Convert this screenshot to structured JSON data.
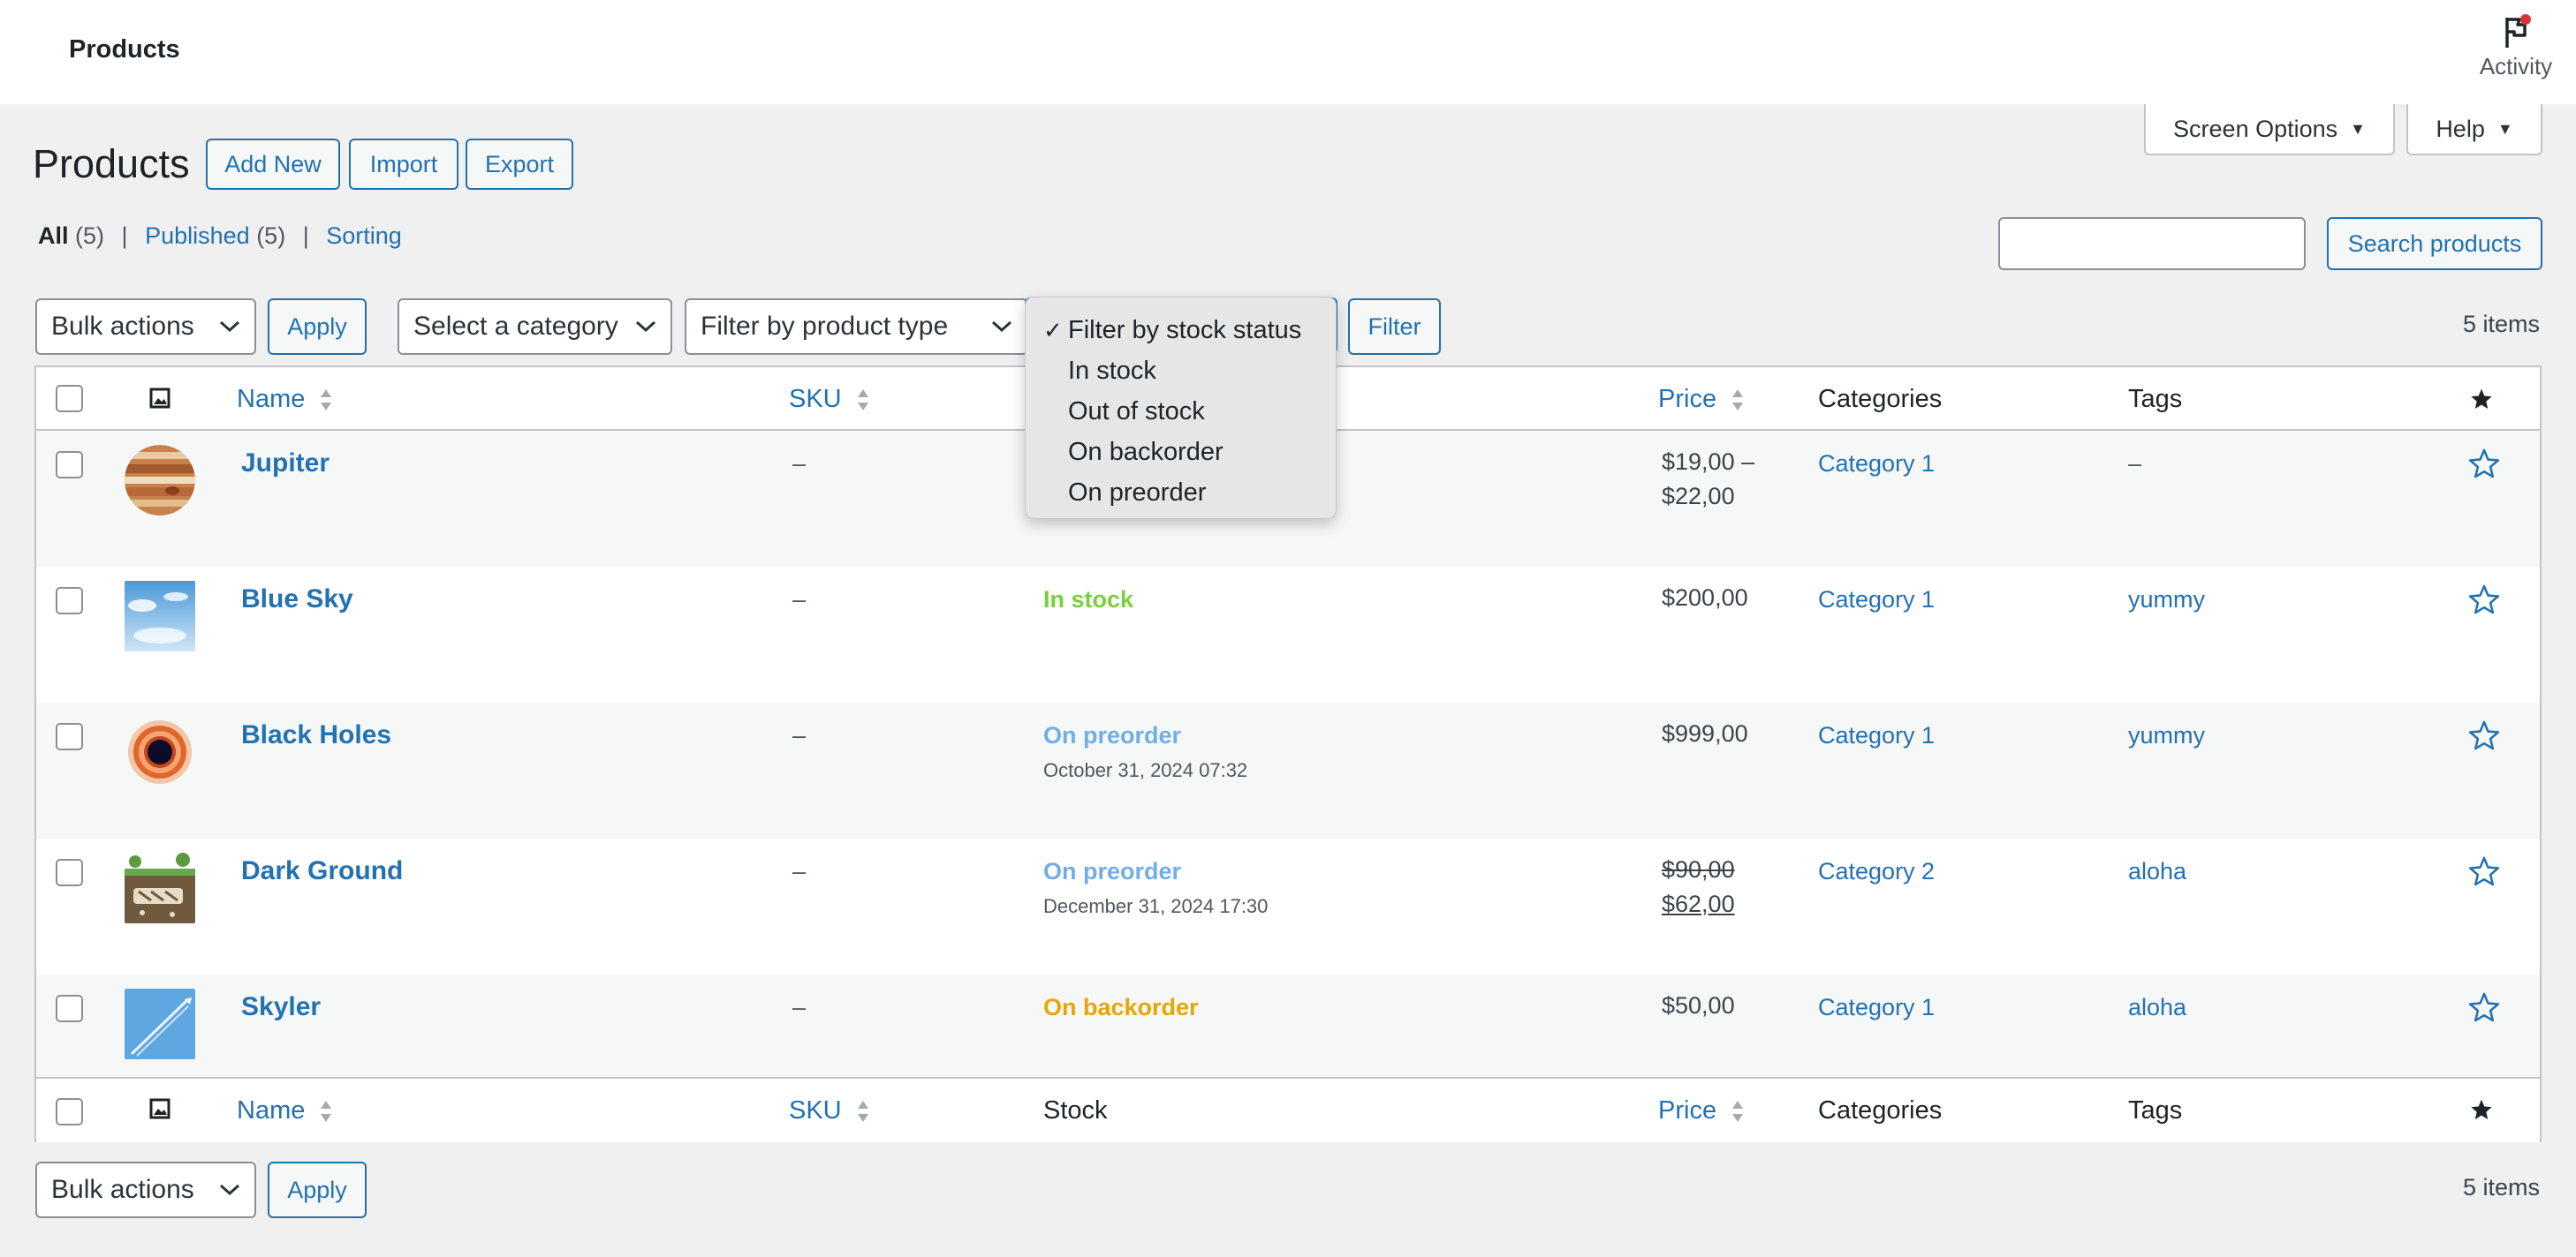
{
  "topbar": {
    "title": "Products",
    "activity_label": "Activity"
  },
  "screen_options": {
    "label": "Screen Options"
  },
  "help": {
    "label": "Help"
  },
  "page": {
    "title": "Products",
    "buttons": {
      "add_new": "Add New",
      "import": "Import",
      "export": "Export"
    }
  },
  "views": {
    "all_label": "All",
    "all_count": "(5)",
    "published_label": "Published",
    "published_count": "(5)",
    "sorting_label": "Sorting",
    "sep": "|"
  },
  "search": {
    "value": "",
    "button": "Search products"
  },
  "filters": {
    "bulk_actions": "Bulk actions",
    "apply": "Apply",
    "category": "Select a category",
    "product_type": "Filter by product type",
    "filter_button": "Filter",
    "items_count": "5 items"
  },
  "stock_dropdown": {
    "options": [
      "Filter by stock status",
      "In stock",
      "Out of stock",
      "On backorder",
      "On preorder"
    ],
    "selected": "Filter by stock status",
    "check": "✓"
  },
  "columns": {
    "name": "Name",
    "sku": "SKU",
    "stock": "Stock",
    "price": "Price",
    "categories": "Categories",
    "tags": "Tags"
  },
  "products": [
    {
      "name": "Jupiter",
      "sku": "–",
      "stock": "",
      "stock_date": "",
      "price_line1": "$19,00 –",
      "price_line2": "$22,00",
      "price_old": "",
      "category": "Category 1",
      "tag": "–",
      "tag_is_link": false
    },
    {
      "name": "Blue Sky",
      "sku": "–",
      "stock": "In stock",
      "stock_date": "",
      "price_line1": "$200,00",
      "price_line2": "",
      "price_old": "",
      "category": "Category 1",
      "tag": "yummy",
      "tag_is_link": true
    },
    {
      "name": "Black Holes",
      "sku": "–",
      "stock": "On preorder",
      "stock_date": "October 31, 2024 07:32",
      "price_line1": "$999,00",
      "price_line2": "",
      "price_old": "",
      "category": "Category 1",
      "tag": "yummy",
      "tag_is_link": true
    },
    {
      "name": "Dark Ground",
      "sku": "–",
      "stock": "On preorder",
      "stock_date": "December 31, 2024 17:30",
      "price_line1": "$90,00",
      "price_line2": "$62,00",
      "price_old": "$90,00",
      "category": "Category 2",
      "tag": "aloha",
      "tag_is_link": true
    },
    {
      "name": "Skyler",
      "sku": "–",
      "stock": "On backorder",
      "stock_date": "",
      "price_line1": "$50,00",
      "price_line2": "",
      "price_old": "",
      "category": "Category 1",
      "tag": "aloha",
      "tag_is_link": true
    }
  ],
  "colors": {
    "link": "#2271b1",
    "in_stock": "#7ad03a",
    "on_preorder": "#72aee6",
    "on_backorder": "#eaa600"
  }
}
